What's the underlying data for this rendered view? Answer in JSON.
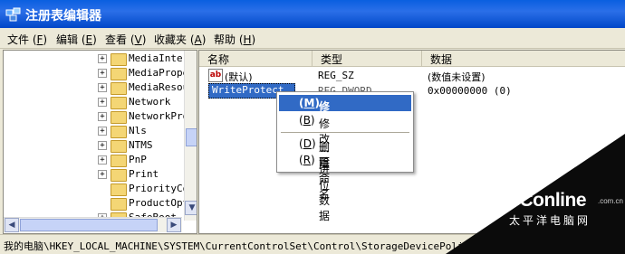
{
  "window": {
    "title": "注册表编辑器",
    "accent": "#0a5fe0"
  },
  "menu": [
    {
      "label": "文件",
      "key": "F"
    },
    {
      "label": "编辑",
      "key": "E"
    },
    {
      "label": "查看",
      "key": "V"
    },
    {
      "label": "收藏夹",
      "key": "A"
    },
    {
      "label": "帮助",
      "key": "H"
    }
  ],
  "tree": {
    "items": [
      {
        "label": "MediaInter",
        "expander": "+"
      },
      {
        "label": "MediaPrope",
        "expander": "+"
      },
      {
        "label": "MediaResou",
        "expander": "+"
      },
      {
        "label": "Network",
        "expander": "+"
      },
      {
        "label": "NetworkPro",
        "expander": "+"
      },
      {
        "label": "Nls",
        "expander": "+"
      },
      {
        "label": "NTMS",
        "expander": "+"
      },
      {
        "label": "PnP",
        "expander": "+"
      },
      {
        "label": "Print",
        "expander": "+"
      },
      {
        "label": "PriorityCo",
        "expander": ""
      },
      {
        "label": "ProductOpt",
        "expander": ""
      },
      {
        "label": "SafeBoot",
        "expander": "+"
      }
    ]
  },
  "list": {
    "columns": [
      "名称",
      "类型",
      "数据"
    ],
    "rows": [
      {
        "icon": "ab",
        "name": "(默认)",
        "type": "REG_SZ",
        "data": "(数值未设置)"
      },
      {
        "icon": "bin",
        "name": "WriteProtect",
        "type": "REG_DWORD",
        "data": "0x00000000  (0)"
      }
    ]
  },
  "context_menu": {
    "items": [
      {
        "label": "修改",
        "key": "M",
        "highlighted": true
      },
      {
        "label": "修改二进位数据",
        "key": "B",
        "highlighted": false
      },
      {
        "label": "删除",
        "key": "D",
        "highlighted": false
      },
      {
        "label": "重命名",
        "key": "R",
        "highlighted": false
      }
    ]
  },
  "status": {
    "path": "我的电脑\\HKEY_LOCAL_MACHINE\\SYSTEM\\CurrentControlSet\\Control\\StorageDevicePolicies"
  },
  "watermark": {
    "brand": "PConline",
    "sub": "太平洋电脑网",
    "domain": ".com.cn"
  }
}
